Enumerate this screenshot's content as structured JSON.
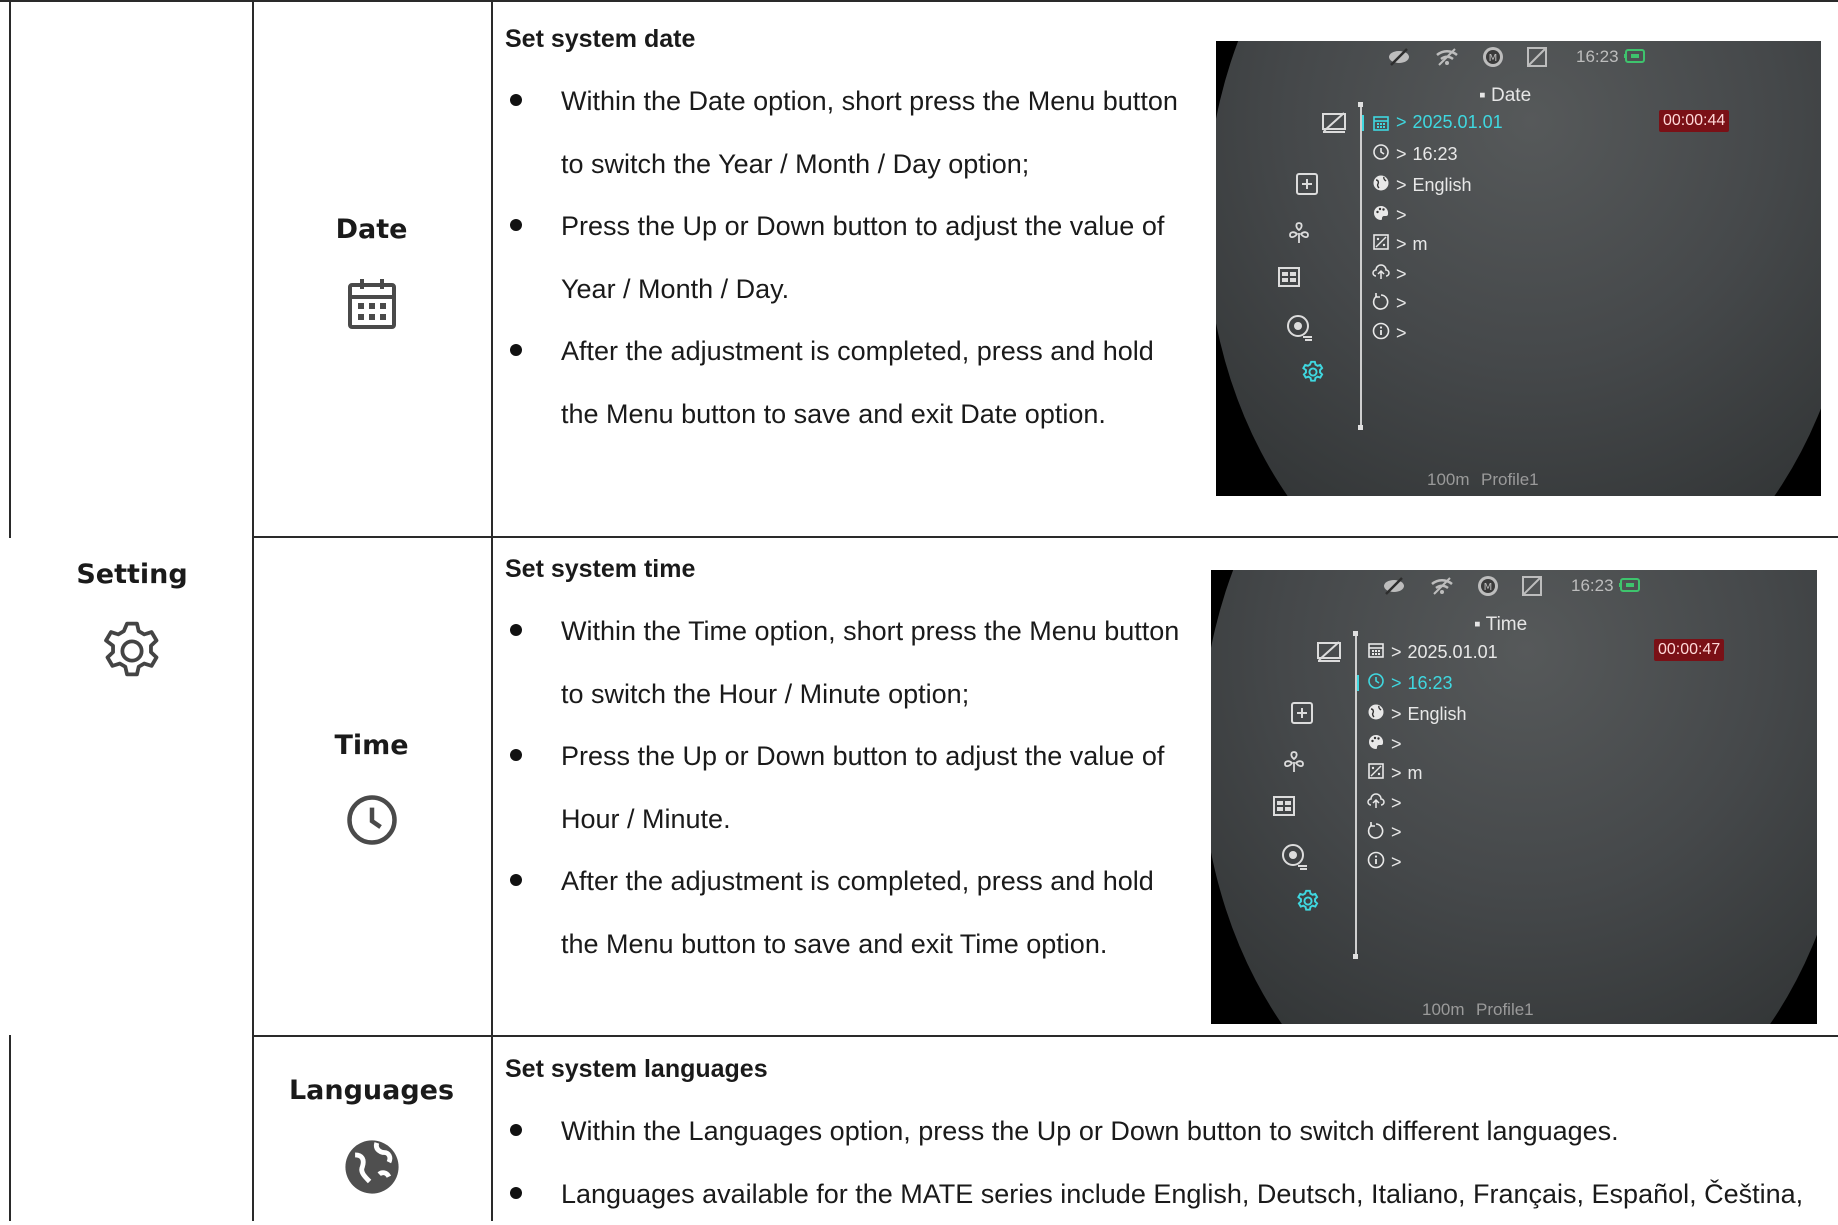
{
  "category": {
    "label": "Setting",
    "icon": "gear-icon"
  },
  "rows": [
    {
      "label": "Date",
      "icon": "calendar-icon",
      "heading": "Set system date",
      "bullets": [
        "Within the Date option, short press the Menu button to switch the Year / Month / Day option;",
        "Press the Up or Down button to adjust the value of Year / Month / Day.",
        "After the adjustment is completed, press and hold the Menu button to save and exit Date option."
      ],
      "screen": {
        "clock": "16:23",
        "title": "Date",
        "timer": "00:00:44",
        "active_item": "date",
        "menu": {
          "date": "2025.01.01",
          "time": "16:23",
          "language": "English",
          "palette": "",
          "units": "m",
          "upload": "",
          "reset": "",
          "info": ""
        },
        "footer_range": "100m",
        "footer_profile": "Profile1"
      }
    },
    {
      "label": "Time",
      "icon": "clock-icon",
      "heading": "Set system time",
      "bullets": [
        "Within the Time option, short press the Menu button to switch the Hour / Minute option;",
        "Press the Up or Down button to adjust the value of Hour / Minute.",
        "After the adjustment is completed, press and hold the Menu button to save and exit Time option."
      ],
      "screen": {
        "clock": "16:23",
        "title": "Time",
        "timer": "00:00:47",
        "active_item": "time",
        "menu": {
          "date": "2025.01.01",
          "time": "16:23",
          "language": "English",
          "palette": "",
          "units": "m",
          "upload": "",
          "reset": "",
          "info": ""
        },
        "footer_range": "100m",
        "footer_profile": "Profile1"
      }
    },
    {
      "label": "Languages",
      "icon": "globe-icon",
      "heading": "Set system languages",
      "bullets": [
        "Within the Languages option, press the Up or Down button to switch different languages.",
        "Languages available for the MATE series include English, Deutsch, Italiano, Français, Español, Čeština,"
      ]
    }
  ],
  "colors": {
    "highlight": "#3fd8e0",
    "timer_bg": "#7a1016",
    "border": "#2a2a2a"
  }
}
